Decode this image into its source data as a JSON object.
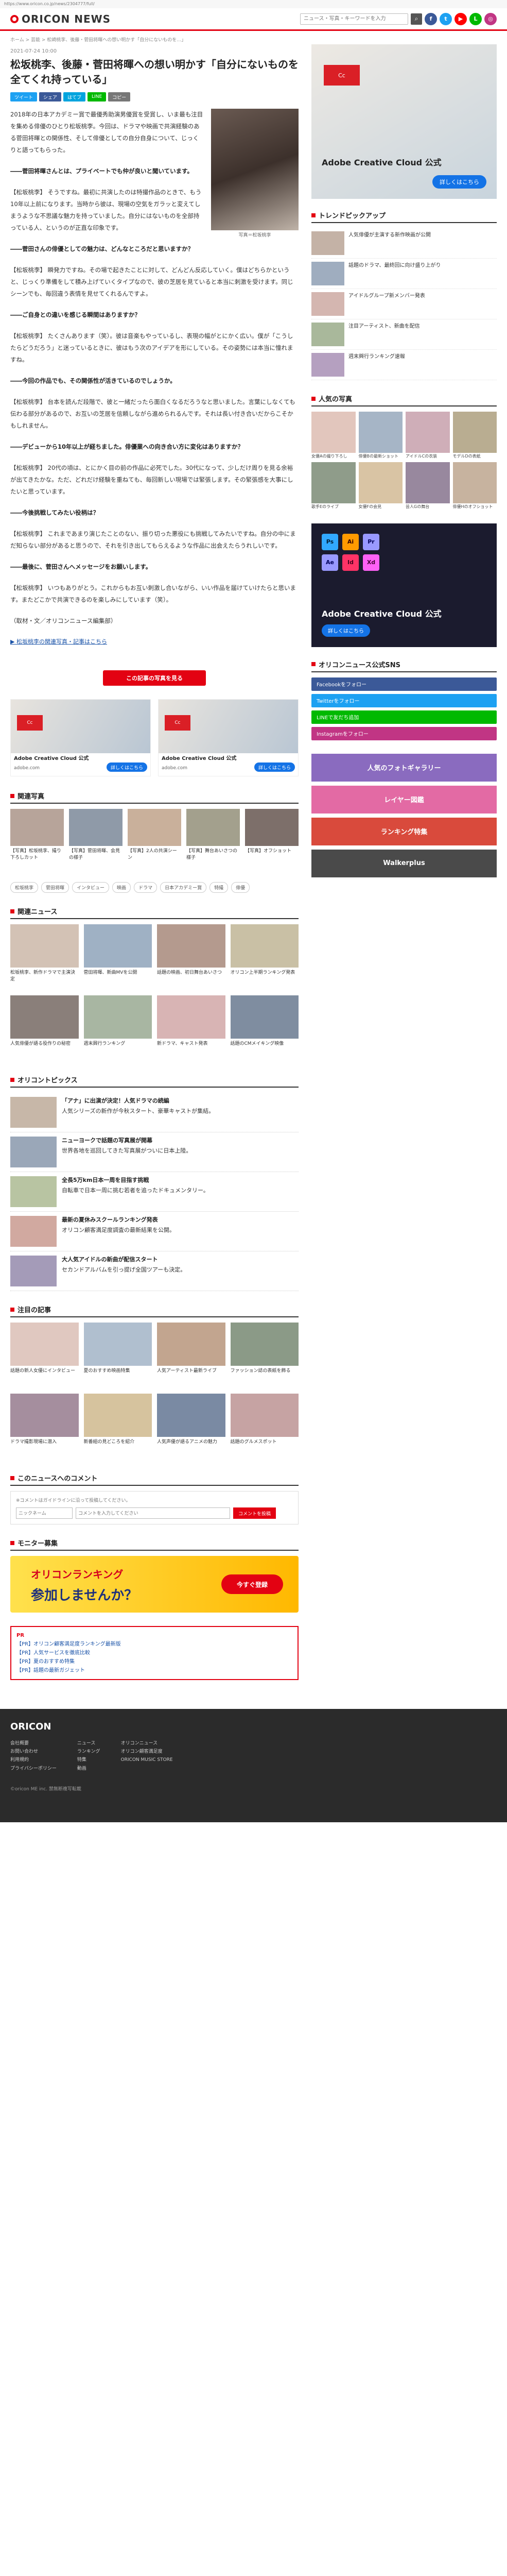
{
  "browser": {
    "url": "https://www.oricon.co.jp/news/2304777/full/"
  },
  "header": {
    "logo": "ORICON NEWS",
    "search_placeholder": "ニュース・写真・キーワードを入力",
    "search_icon": "search-icon",
    "social": [
      {
        "label": "f",
        "color": "#3b5998"
      },
      {
        "label": "t",
        "color": "#1da1f2"
      },
      {
        "label": "▶",
        "color": "#ff0000"
      },
      {
        "label": "L",
        "color": "#00b900"
      },
      {
        "label": "◎",
        "color": "#c13584"
      }
    ]
  },
  "breadcrumb": "ホーム > 芸能 > 松崎桃李、後藤・菅田将暉への想い明かす「自分にないものを…」",
  "article": {
    "date": "2021-07-24 10:00",
    "title": "松坂桃李、後藤・菅田将暉への想い明かす「自分にないものを全てくれ持っている」",
    "share": [
      {
        "label": "ツイート",
        "color": "#1da1f2"
      },
      {
        "label": "シェア",
        "color": "#3b5998"
      },
      {
        "label": "はてブ",
        "color": "#00a4de"
      },
      {
        "label": "LINE",
        "color": "#00b900"
      },
      {
        "label": "コピー",
        "color": "#777777"
      }
    ],
    "photo_caption": "写真＝松坂桃李",
    "paragraphs": [
      "2018年の日本アカデミー賞で最優秀助演男優賞を受賞し、いま最も注目を集める俳優のひとり松坂桃李。今回は、ドラマや映画で共演経験のある菅田将暉との関係性、そして俳優としての自分自身について、じっくりと語ってもらった。",
      "――菅田将暉さんとは、プライベートでも仲が良いと聞いています。",
      "【松坂桃李】 そうですね。最初に共演したのは特撮作品のときで、もう10年以上前になります。当時から彼は、現場の空気をガラッと変えてしまうような不思議な魅力を持っていました。自分にはないものを全部持っている人、というのが正直な印象です。",
      "――菅田さんの俳優としての魅力は、どんなところだと思いますか？",
      "【松坂桃李】 瞬発力ですね。その場で起きたことに対して、どんどん反応していく。僕はどちらかというと、じっくり準備をして積み上げていくタイプなので、彼の芝居を見ていると本当に刺激を受けます。同じシーンでも、毎回違う表情を見せてくれるんですよ。",
      "――ご自身との違いを感じる瞬間はありますか？",
      "【松坂桃李】 たくさんあります（笑）。彼は音楽もやっているし、表現の幅がとにかく広い。僕が「こうしたらどうだろう」と迷っているときに、彼はもう次のアイデアを形にしている。その姿勢には本当に憧れますね。",
      "――今回の作品でも、その関係性が活きているのでしょうか。",
      "【松坂桃李】 台本を読んだ段階で、彼と一緒だったら面白くなるだろうなと思いました。言葉にしなくても伝わる部分があるので、お互いの芝居を信頼しながら進められるんです。それは長い付き合いだからこそかもしれません。",
      "――デビューから10年以上が経ちました。俳優業への向き合い方に変化はありますか？",
      "【松坂桃李】 20代の頃は、とにかく目の前の作品に必死でした。30代になって、少しだけ周りを見る余裕が出てきたかな。ただ、どれだけ経験を重ねても、毎回新しい現場では緊張します。その緊張感を大事にしたいと思っています。",
      "――今後挑戦してみたい役柄は？",
      "【松坂桃李】 これまであまり演じたことのない、振り切った悪役にも挑戦してみたいですね。自分の中にまだ知らない部分があると思うので、それを引き出してもらえるような作品に出会えたらうれしいです。",
      "――最後に、菅田さんへメッセージをお願いします。",
      "【松坂桃李】 いつもありがとう。これからもお互い刺激し合いながら、いい作品を届けていけたらと思います。またどこかで共演できるのを楽しみにしています（笑）。",
      "（取材・文／オリコンニュース編集部）"
    ],
    "related_link": "▶ 松坂桃李の関連写真・記事はこちら",
    "more_photo_button": "この記事の写真を見る",
    "ads": [
      {
        "badge": "Cc",
        "title": "Adobe Creative Cloud 公式",
        "sub": "adobe.com",
        "cta": "詳しくはこちら"
      },
      {
        "badge": "Cc",
        "title": "Adobe Creative Cloud 公式",
        "sub": "adobe.com",
        "cta": "詳しくはこちら"
      }
    ]
  },
  "sections": {
    "related_photos": {
      "title": "関連写真",
      "cards": [
        "【写真】松坂桃李、撮り下ろしカット",
        "【写真】菅田将暉、会見の様子",
        "【写真】2人の共演シーン",
        "【写真】舞台あいさつの様子",
        "【写真】オフショット"
      ]
    },
    "tags": [
      "松坂桃李",
      "菅田将暉",
      "インタビュー",
      "映画",
      "ドラマ",
      "日本アカデミー賞",
      "特撮",
      "俳優"
    ],
    "photo_grid": {
      "title": "関連ニュース",
      "cards": [
        "松坂桃李、新作ドラマで主演決定",
        "菅田将暉、新曲MVを公開",
        "話題の映画、初日舞台あいさつ",
        "オリコン上半期ランキング発表",
        "人気俳優が語る役作りの秘密",
        "週末興行ランキング",
        "新ドラマ、キャスト発表",
        "話題のCMメイキング映像"
      ]
    },
    "news_list": {
      "title": "オリコントピックス",
      "items": [
        {
          "title": "「アナ」に出演が決定！人気ドラマの続編",
          "text": "人気シリーズの新作が今秋スタート、豪華キャストが集結。"
        },
        {
          "title": "ニューヨークで話題の写真展が開幕",
          "text": "世界各地を巡回してきた写真展がついに日本上陸。"
        },
        {
          "title": "全長5万km日本一周を目指す挑戦",
          "text": "自転車で日本一周に挑む若者を追ったドキュメンタリー。"
        },
        {
          "title": "最新の夏休みスクールランキング発表",
          "text": "オリコン顧客満足度調査の最新結果を公開。"
        },
        {
          "title": "大人気アイドルの新曲が配信スタート",
          "text": "セカンドアルバムを引っ提げ全国ツアーも決定。"
        }
      ]
    },
    "more_grid": {
      "title": "注目の記事",
      "cards": [
        "話題の新人女優にインタビュー",
        "夏のおすすめ映画特集",
        "人気アーティスト最新ライブ",
        "ファッション誌の表紙を飾る",
        "ドラマ撮影現場に潜入",
        "新番組の見どころを紹介",
        "人気声優が語るアニメの魅力",
        "話題のグルメスポット"
      ]
    },
    "comments": {
      "title": "このニュースへのコメント",
      "note": "※コメントはガイドラインに沿って投稿してください。",
      "name_placeholder": "ニックネーム",
      "text_placeholder": "コメントを入力してください",
      "submit": "コメントを投稿"
    },
    "monitor": {
      "title": "モニター募集",
      "banner_line1": "オリコンランキング",
      "banner_line2": "参加しませんか？",
      "banner_cta": "今すぐ登録"
    },
    "pr": {
      "title": "PR",
      "items": [
        "【PR】オリコン顧客満足度ランキング最新版",
        "【PR】人気サービスを徹底比較",
        "【PR】夏のおすすめ特集",
        "【PR】話題の最新ガジェット"
      ]
    }
  },
  "sidebar": {
    "ad": {
      "badge": "Cc",
      "title": "Adobe Creative Cloud 公式",
      "cta": "詳しくはこちら"
    },
    "trending": {
      "title": "トレンドピックアップ",
      "items": [
        "人気俳優が主演する新作映画が公開",
        "話題のドラマ、最終回に向け盛り上がり",
        "アイドルグループ新メンバー発表",
        "注目アーティスト、新曲を配信",
        "週末興行ランキング速報"
      ]
    },
    "gallery": {
      "title": "人気の写真",
      "cards": [
        "女優Aの撮り下ろし",
        "俳優Bの最新ショット",
        "アイドルCの衣装",
        "モデルDの表紙",
        "歌手Eのライブ",
        "女優Fの会見",
        "芸人Gの舞台",
        "俳優Hのオフショット"
      ]
    },
    "apps_ad": {
      "title": "Adobe Creative Cloud 公式",
      "cta": "詳しくはこちら",
      "icons": [
        "Ps",
        "Ai",
        "Pr",
        "Ae",
        "Id",
        "Xd"
      ]
    },
    "follow": {
      "title": "オリコンニュース公式SNS",
      "buttons": [
        {
          "label": "Facebookをフォロー",
          "color": "#3b5998"
        },
        {
          "label": "Twitterをフォロー",
          "color": "#1da1f2"
        },
        {
          "label": "LINEで友だち追加",
          "color": "#00b900"
        },
        {
          "label": "Instagramをフォロー",
          "color": "#c13584"
        }
      ]
    },
    "banners": [
      {
        "label": "人気のフォトギャラリー",
        "color": "#8a6bbf"
      },
      {
        "label": "レイヤー図鑑",
        "color": "#e36aa4"
      },
      {
        "label": "ランキング特集",
        "color": "#d94a3c"
      },
      {
        "label": "Walkerplus",
        "color": "#4a4a4a"
      }
    ]
  },
  "footer": {
    "logo": "ORICON",
    "cols": [
      [
        "会社概要",
        "お問い合わせ",
        "利用規約",
        "プライバシーポリシー"
      ],
      [
        "ニュース",
        "ランキング",
        "特集",
        "動画"
      ],
      [
        "オリコンニュース",
        "オリコン顧客満足度",
        "ORICON MUSIC STORE"
      ]
    ],
    "copyright": "©oricon ME inc. 禁無断複写転載"
  }
}
